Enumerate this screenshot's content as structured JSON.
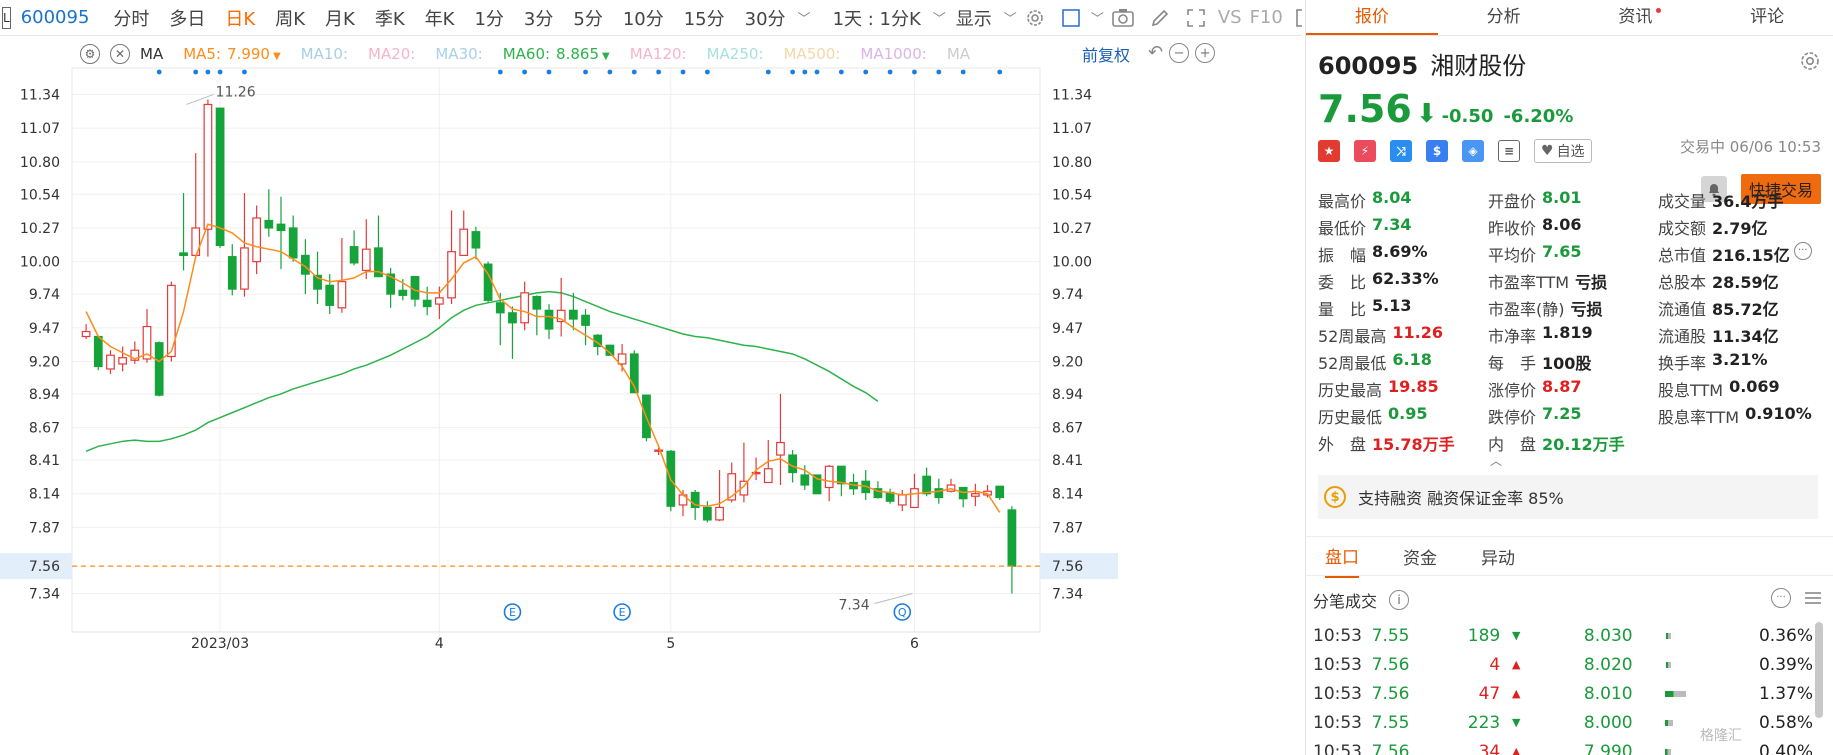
{
  "toolbar": {
    "code": "600095",
    "tabs": [
      "分时",
      "多日",
      "日K",
      "周K",
      "月K",
      "季K",
      "年K",
      "1分",
      "3分",
      "5分",
      "10分",
      "15分",
      "30分"
    ],
    "active_tab": "日K",
    "period_label": "1天 : 1分K",
    "display_label": "显示",
    "vs_label": "VS",
    "f10_label": "F10",
    "box_label": "L"
  },
  "ma_legend": {
    "label": "MA",
    "items": [
      {
        "name": "MA5:",
        "value": "7.990",
        "color": "#ff8c1a"
      },
      {
        "name": "MA10:",
        "value": "",
        "color": "#a8cfe8"
      },
      {
        "name": "MA20:",
        "value": "",
        "color": "#f5b5c8"
      },
      {
        "name": "MA30:",
        "value": "",
        "color": "#a8cfe8"
      },
      {
        "name": "MA60:",
        "value": "8.865",
        "color": "#2db34a"
      },
      {
        "name": "MA120:",
        "value": "",
        "color": "#f5b5c8"
      },
      {
        "name": "MA250:",
        "value": "",
        "color": "#a8e0e0"
      },
      {
        "name": "MA500:",
        "value": "",
        "color": "#f5d8a8"
      },
      {
        "name": "MA1000:",
        "value": "",
        "color": "#d9b5e8"
      },
      {
        "name": "MA",
        "value": "",
        "color": "#cccccc"
      }
    ],
    "restore_label": "前复权"
  },
  "chart_data": {
    "type": "candlestick",
    "y_ticks": [
      "11.34",
      "11.07",
      "10.80",
      "10.54",
      "10.27",
      "10.00",
      "9.74",
      "9.47",
      "9.20",
      "8.94",
      "8.67",
      "8.41",
      "8.14",
      "7.87",
      "7.56",
      "7.34"
    ],
    "ylim": [
      7.16,
      11.52
    ],
    "x_labels": [
      {
        "label": "2023/03",
        "index": 11
      },
      {
        "label": "4",
        "index": 29
      },
      {
        "label": "5",
        "index": 48
      },
      {
        "label": "6",
        "index": 68
      }
    ],
    "current_price": "7.56",
    "high_annotation": {
      "label": "11.26",
      "index": 8
    },
    "low_annotation": {
      "label": "7.34",
      "index": 68
    },
    "event_markers": [
      {
        "label": "E",
        "index": 35
      },
      {
        "label": "E",
        "index": 44
      },
      {
        "label": "Q",
        "index": 67
      }
    ],
    "signal_dot_indices": [
      6,
      9,
      10,
      11,
      13,
      34,
      36,
      38,
      41,
      43,
      45,
      47,
      49,
      51,
      56,
      58,
      59,
      60,
      62,
      64,
      66,
      68,
      70,
      72,
      75,
      78,
      80,
      82,
      85,
      87
    ],
    "colors": {
      "up": "#e33b3b",
      "down": "#15a33a",
      "ma5": "#ff8c1a",
      "ma60": "#2db34a"
    },
    "candles": [
      [
        9.4,
        9.44,
        9.38,
        9.5
      ],
      [
        9.4,
        9.16,
        9.13,
        9.41
      ],
      [
        9.14,
        9.25,
        9.1,
        9.29
      ],
      [
        9.18,
        9.23,
        9.12,
        9.32
      ],
      [
        9.21,
        9.29,
        9.18,
        9.36
      ],
      [
        9.22,
        9.48,
        9.19,
        9.62
      ],
      [
        9.35,
        8.93,
        8.92,
        9.36
      ],
      [
        9.24,
        9.81,
        9.2,
        9.84
      ],
      [
        10.07,
        10.05,
        9.93,
        10.55
      ],
      [
        10.05,
        10.27,
        10.03,
        10.87
      ],
      [
        10.26,
        11.26,
        10.04,
        11.3
      ],
      [
        11.23,
        10.13,
        10.11,
        11.23
      ],
      [
        10.04,
        9.78,
        9.73,
        10.14
      ],
      [
        9.78,
        10.11,
        9.72,
        10.55
      ],
      [
        10.0,
        10.35,
        9.9,
        10.45
      ],
      [
        10.33,
        10.27,
        10.2,
        10.58
      ],
      [
        10.3,
        10.25,
        9.94,
        10.52
      ],
      [
        10.27,
        10.03,
        10.0,
        10.37
      ],
      [
        10.05,
        9.9,
        9.74,
        10.18
      ],
      [
        9.89,
        9.78,
        9.66,
        10.08
      ],
      [
        9.81,
        9.65,
        9.58,
        9.9
      ],
      [
        9.63,
        9.84,
        9.59,
        10.19
      ],
      [
        10.12,
        9.99,
        9.97,
        10.25
      ],
      [
        9.93,
        10.1,
        9.86,
        10.34
      ],
      [
        10.11,
        9.88,
        9.89,
        10.37
      ],
      [
        9.9,
        9.74,
        9.63,
        9.95
      ],
      [
        9.77,
        9.73,
        9.69,
        9.86
      ],
      [
        9.88,
        9.7,
        9.64,
        9.87
      ],
      [
        9.69,
        9.64,
        9.57,
        9.8
      ],
      [
        9.66,
        9.71,
        9.54,
        9.8
      ],
      [
        9.71,
        10.08,
        9.66,
        10.41
      ],
      [
        10.05,
        10.26,
        10.05,
        10.41
      ],
      [
        10.24,
        10.11,
        10.02,
        10.28
      ],
      [
        9.98,
        9.69,
        9.67,
        10.0
      ],
      [
        9.67,
        9.59,
        9.33,
        9.75
      ],
      [
        9.59,
        9.51,
        9.22,
        9.64
      ],
      [
        9.51,
        9.75,
        9.45,
        9.84
      ],
      [
        9.72,
        9.62,
        9.41,
        9.73
      ],
      [
        9.61,
        9.46,
        9.38,
        9.66
      ],
      [
        9.52,
        9.61,
        9.4,
        9.87
      ],
      [
        9.61,
        9.54,
        9.45,
        9.75
      ],
      [
        9.57,
        9.49,
        9.33,
        9.62
      ],
      [
        9.41,
        9.32,
        9.25,
        9.42
      ],
      [
        9.33,
        9.25,
        9.28,
        9.3
      ],
      [
        9.18,
        9.26,
        9.12,
        9.34
      ],
      [
        9.26,
        8.95,
        8.95,
        9.29
      ],
      [
        8.93,
        8.59,
        8.56,
        8.91
      ],
      [
        8.48,
        8.49,
        8.45,
        8.51
      ],
      [
        8.48,
        8.04,
        8.0,
        8.49
      ],
      [
        8.05,
        8.13,
        7.96,
        8.17
      ],
      [
        8.15,
        8.03,
        7.93,
        8.17
      ],
      [
        8.03,
        7.93,
        7.91,
        8.08
      ],
      [
        7.93,
        8.03,
        7.92,
        8.33
      ],
      [
        8.09,
        8.3,
        8.07,
        8.39
      ],
      [
        8.13,
        8.24,
        8.07,
        8.55
      ],
      [
        8.31,
        8.31,
        8.25,
        8.43
      ],
      [
        8.23,
        8.34,
        8.23,
        8.57
      ],
      [
        8.45,
        8.55,
        8.21,
        8.94
      ],
      [
        8.45,
        8.31,
        8.23,
        8.49
      ],
      [
        8.29,
        8.21,
        8.17,
        8.37
      ],
      [
        8.29,
        8.14,
        8.14,
        8.29
      ],
      [
        8.19,
        8.36,
        8.08,
        8.37
      ],
      [
        8.36,
        8.22,
        8.12,
        8.33
      ],
      [
        8.23,
        8.18,
        8.13,
        8.3
      ],
      [
        8.24,
        8.15,
        8.09,
        8.33
      ],
      [
        8.18,
        8.11,
        8.1,
        8.24
      ],
      [
        8.15,
        8.08,
        8.06,
        8.18
      ],
      [
        8.05,
        8.13,
        8.0,
        8.17
      ],
      [
        8.03,
        8.18,
        8.04,
        8.3
      ],
      [
        8.28,
        8.14,
        8.12,
        8.35
      ],
      [
        8.18,
        8.11,
        8.06,
        8.26
      ],
      [
        8.16,
        8.21,
        8.15,
        8.26
      ],
      [
        8.19,
        8.1,
        8.03,
        8.18
      ],
      [
        8.12,
        8.14,
        8.04,
        8.22
      ],
      [
        8.13,
        8.16,
        8.11,
        8.21
      ],
      [
        8.2,
        8.11,
        8.09,
        8.2
      ],
      [
        8.01,
        7.56,
        7.34,
        8.04
      ]
    ],
    "ma5": [
      9.6,
      9.4,
      9.32,
      9.27,
      9.22,
      9.26,
      9.2,
      9.28,
      9.6,
      10.04,
      10.3,
      10.27,
      10.23,
      10.15,
      10.12,
      10.1,
      10.08,
      10.02,
      9.96,
      9.87,
      9.84,
      9.85,
      9.87,
      9.92,
      9.92,
      9.88,
      9.83,
      9.77,
      9.75,
      9.75,
      9.86,
      9.99,
      10.04,
      9.9,
      9.7,
      9.62,
      9.6,
      9.56,
      9.56,
      9.54,
      9.47,
      9.41,
      9.35,
      9.27,
      9.16,
      9.0,
      8.75,
      8.52,
      8.25,
      8.13,
      8.05,
      8.04,
      8.06,
      8.12,
      8.2,
      8.33,
      8.4,
      8.42,
      8.36,
      8.33,
      8.26,
      8.24,
      8.23,
      8.21,
      8.2,
      8.16,
      8.15,
      8.13,
      8.14,
      8.15,
      8.16,
      8.18,
      8.15,
      8.16,
      8.14,
      7.99
    ],
    "ma60": [
      8.48,
      8.52,
      8.54,
      8.56,
      8.57,
      8.56,
      8.56,
      8.58,
      8.61,
      8.65,
      8.71,
      8.75,
      8.79,
      8.83,
      8.87,
      8.91,
      8.94,
      8.98,
      9.01,
      9.04,
      9.07,
      9.1,
      9.14,
      9.17,
      9.21,
      9.25,
      9.3,
      9.35,
      9.4,
      9.47,
      9.55,
      9.61,
      9.65,
      9.67,
      9.69,
      9.71,
      9.73,
      9.75,
      9.76,
      9.75,
      9.72,
      9.68,
      9.64,
      9.6,
      9.57,
      9.54,
      9.51,
      9.48,
      9.45,
      9.42,
      9.4,
      9.39,
      9.37,
      9.35,
      9.33,
      9.32,
      9.3,
      9.28,
      9.26,
      9.22,
      9.17,
      9.12,
      9.06,
      9.0,
      8.95,
      8.88
    ]
  },
  "right_panel": {
    "tabs": [
      {
        "label": "报价",
        "active": true
      },
      {
        "label": "分析"
      },
      {
        "label": "资讯",
        "dot": true
      },
      {
        "label": "评论"
      }
    ],
    "code": "600095",
    "name": "湘财股份",
    "price": "7.56",
    "change": "-0.50",
    "change_pct": "-6.20%",
    "status_time": "交易中 06/06 10:53",
    "fav_label": "自选",
    "quick_trade": "快捷交易",
    "stats": [
      [
        {
          "label": "最高价",
          "value": "8.04",
          "color": "green"
        },
        {
          "label": "开盘价",
          "value": "8.01",
          "color": "green"
        },
        {
          "label": "成交量",
          "value": "36.4万手",
          "color": "black"
        }
      ],
      [
        {
          "label": "最低价",
          "value": "7.34",
          "color": "green"
        },
        {
          "label": "昨收价",
          "value": "8.06",
          "color": "black"
        },
        {
          "label": "成交额",
          "value": "2.79亿",
          "color": "black"
        }
      ],
      [
        {
          "label": "振　幅",
          "value": "8.69%",
          "color": "black"
        },
        {
          "label": "平均价",
          "value": "7.65",
          "color": "green"
        },
        {
          "label": "总市值",
          "value": "216.15亿",
          "color": "black"
        }
      ],
      [
        {
          "label": "委　比",
          "value": "62.33%",
          "color": "black"
        },
        {
          "label": "市盈率TTM",
          "value": "亏损",
          "color": "black"
        },
        {
          "label": "总股本",
          "value": "28.59亿",
          "color": "black"
        }
      ],
      [
        {
          "label": "量　比",
          "value": "5.13",
          "color": "black"
        },
        {
          "label": "市盈率(静)",
          "value": "亏损",
          "color": "black"
        },
        {
          "label": "流通值",
          "value": "85.72亿",
          "color": "black"
        }
      ],
      [
        {
          "label": "52周最高",
          "value": "11.26",
          "color": "red"
        },
        {
          "label": "市净率",
          "value": "1.819",
          "color": "black"
        },
        {
          "label": "流通股",
          "value": "11.34亿",
          "color": "black"
        }
      ],
      [
        {
          "label": "52周最低",
          "value": "6.18",
          "color": "green"
        },
        {
          "label": "每　手",
          "value": "100股",
          "color": "black"
        },
        {
          "label": "换手率",
          "value": "3.21%",
          "color": "black"
        }
      ],
      [
        {
          "label": "历史最高",
          "value": "19.85",
          "color": "red"
        },
        {
          "label": "涨停价",
          "value": "8.87",
          "color": "red"
        },
        {
          "label": "股息TTM",
          "value": "0.069",
          "color": "black"
        }
      ],
      [
        {
          "label": "历史最低",
          "value": "0.95",
          "color": "green"
        },
        {
          "label": "跌停价",
          "value": "7.25",
          "color": "green"
        },
        {
          "label": "股息率TTM",
          "value": "0.910%",
          "color": "black"
        }
      ],
      [
        {
          "label": "外　盘",
          "value": "15.78万手",
          "color": "red"
        },
        {
          "label": "内　盘",
          "value": "20.12万手",
          "color": "green"
        },
        {
          "label": "",
          "value": "",
          "color": "black"
        }
      ]
    ],
    "margin_text": "支持融资 融资保证金率 85%",
    "sub_tabs": [
      {
        "label": "盘口",
        "active": true
      },
      {
        "label": "资金"
      },
      {
        "label": "异动"
      }
    ],
    "ticks_title": "分笔成交",
    "ticks": [
      {
        "time": "10:53",
        "price": "7.55",
        "vol": "189",
        "dir": "down",
        "p2": "8.030",
        "bar": 0.05,
        "pct": "0.36%"
      },
      {
        "time": "10:53",
        "price": "7.56",
        "vol": "4",
        "dir": "up",
        "p2": "8.020",
        "bar": 0.05,
        "pct": "0.39%"
      },
      {
        "time": "10:53",
        "price": "7.56",
        "vol": "47",
        "dir": "up",
        "p2": "8.010",
        "bar": 0.22,
        "pct": "1.37%"
      },
      {
        "time": "10:53",
        "price": "7.55",
        "vol": "223",
        "dir": "down",
        "p2": "8.000",
        "bar": 0.08,
        "pct": "0.58%"
      },
      {
        "time": "10:53",
        "price": "7.56",
        "vol": "34",
        "dir": "up",
        "p2": "7.990",
        "bar": 0.06,
        "pct": "0.40%"
      }
    ],
    "watermark": "格隆汇"
  }
}
